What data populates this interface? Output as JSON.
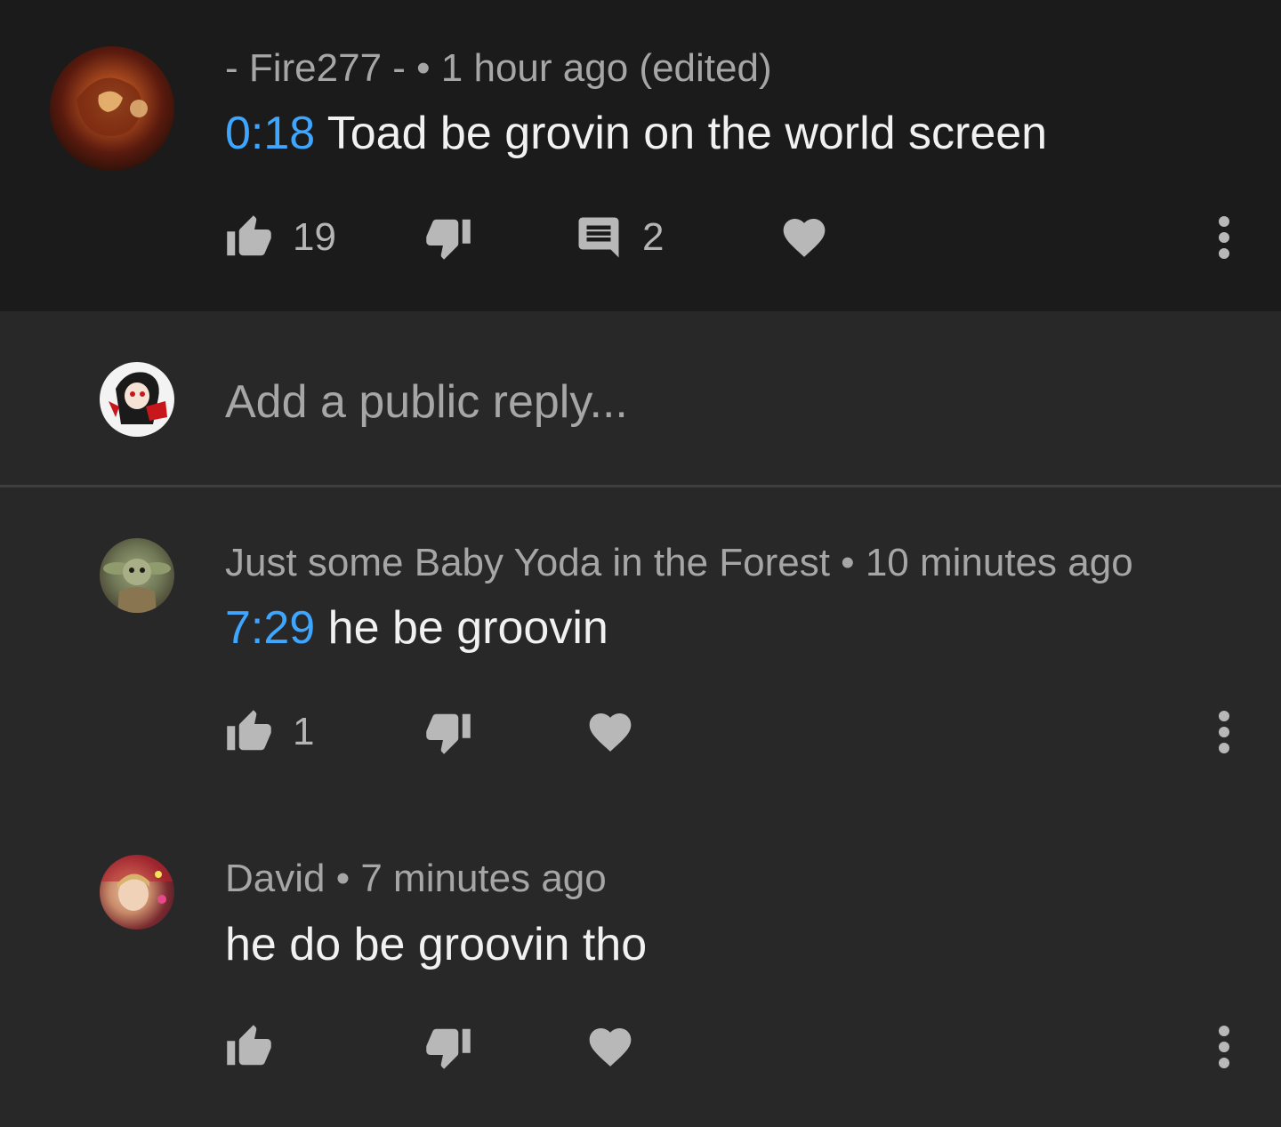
{
  "top_comment": {
    "author_meta": "- Fire277 - • 1 hour ago (edited)",
    "timestamp_link": "0:18",
    "text": " Toad be grovin on the world screen",
    "like_count": "19",
    "reply_count": "2"
  },
  "reply_input": {
    "placeholder": "Add a public reply..."
  },
  "replies": [
    {
      "author_meta": "Just some Baby Yoda in the Forest • 10 minutes ago",
      "timestamp_link": "7:29",
      "text": " he be groovin",
      "like_count": "1"
    },
    {
      "author_meta": "David • 7 minutes ago",
      "timestamp_link": "",
      "text": "he do be groovin tho",
      "like_count": ""
    }
  ],
  "icons": {
    "like": "thumb-up-icon",
    "dislike": "thumb-down-icon",
    "reply": "comment-icon",
    "heart": "heart-icon",
    "more": "more-vert-icon"
  },
  "colors": {
    "link": "#3ea6ff",
    "icon": "#b8b8b8"
  }
}
